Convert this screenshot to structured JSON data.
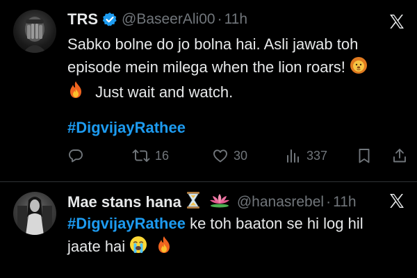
{
  "tweets": [
    {
      "name": "TRS",
      "handle": "@BaseerAli00",
      "dot": "·",
      "time": "11h",
      "line1": "Sabko bolne do jo bolna hai. Asli jawab toh",
      "line2": "episode mein milega when the lion roars!",
      "line3": "Just wait and watch.",
      "hashtag": "#DigvijayRathee",
      "stats": {
        "replies": "",
        "retweets": "16",
        "likes": "30",
        "views": "337"
      }
    },
    {
      "name": "Mae stans hana",
      "handle": "@hanasrebel",
      "dot": "·",
      "time": "11h",
      "hashtag": "#DigvijayRathee",
      "line1_rest": " ke toh baaton se hi log hil",
      "line2": "jaate hai"
    }
  ],
  "icons": {
    "verified": "verified-badge-icon",
    "x_logo": "x-logo-icon",
    "reply": "reply-icon",
    "retweet": "retweet-icon",
    "like": "heart-icon",
    "views": "views-icon",
    "bookmark": "bookmark-icon",
    "share": "share-icon"
  },
  "colors": {
    "background": "#000000",
    "text": "#e7e9ea",
    "muted": "#71767b",
    "accent": "#1d9bf0",
    "divider": "#2f3336"
  }
}
